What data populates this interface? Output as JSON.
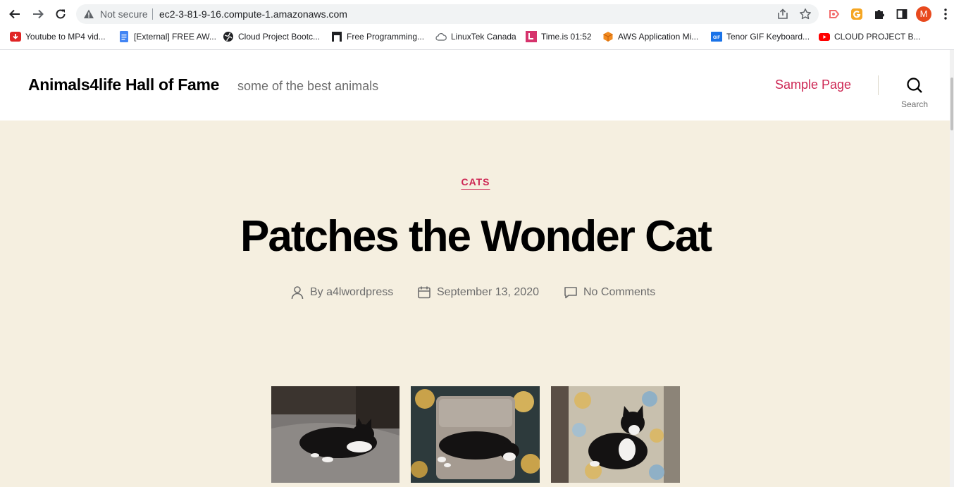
{
  "browser": {
    "security_label": "Not secure",
    "url": "ec2-3-81-9-16.compute-1.amazonaws.com",
    "profile_initial": "M",
    "profile_color": "#e8491d"
  },
  "bookmarks": [
    {
      "label": "Youtube to MP4 vid...",
      "icon": "red-download-icon"
    },
    {
      "label": "[External] FREE AW...",
      "icon": "google-docs-icon"
    },
    {
      "label": "Cloud Project Bootc...",
      "icon": "globe-icon"
    },
    {
      "label": "Free Programming...",
      "icon": "black-square-icon"
    },
    {
      "label": "LinuxTek Canada",
      "icon": "cloud-outline-icon"
    },
    {
      "label": "Time.is 01:52",
      "icon": "timeis-icon"
    },
    {
      "label": "AWS Application Mi...",
      "icon": "aws-box-icon"
    },
    {
      "label": "Tenor GIF Keyboard...",
      "icon": "gif-icon"
    },
    {
      "label": "CLOUD PROJECT B...",
      "icon": "youtube-icon"
    }
  ],
  "site": {
    "title": "Animals4life Hall of Fame",
    "description": "some of the best animals",
    "nav_sample": "Sample Page",
    "search_label": "Search",
    "accent": "#cd2653",
    "background": "#f5efe0"
  },
  "post": {
    "category": "CATS",
    "title": "Patches the Wonder Cat",
    "author_label": "By a4lwordpress",
    "date": "September 13, 2020",
    "comments": "No Comments"
  }
}
